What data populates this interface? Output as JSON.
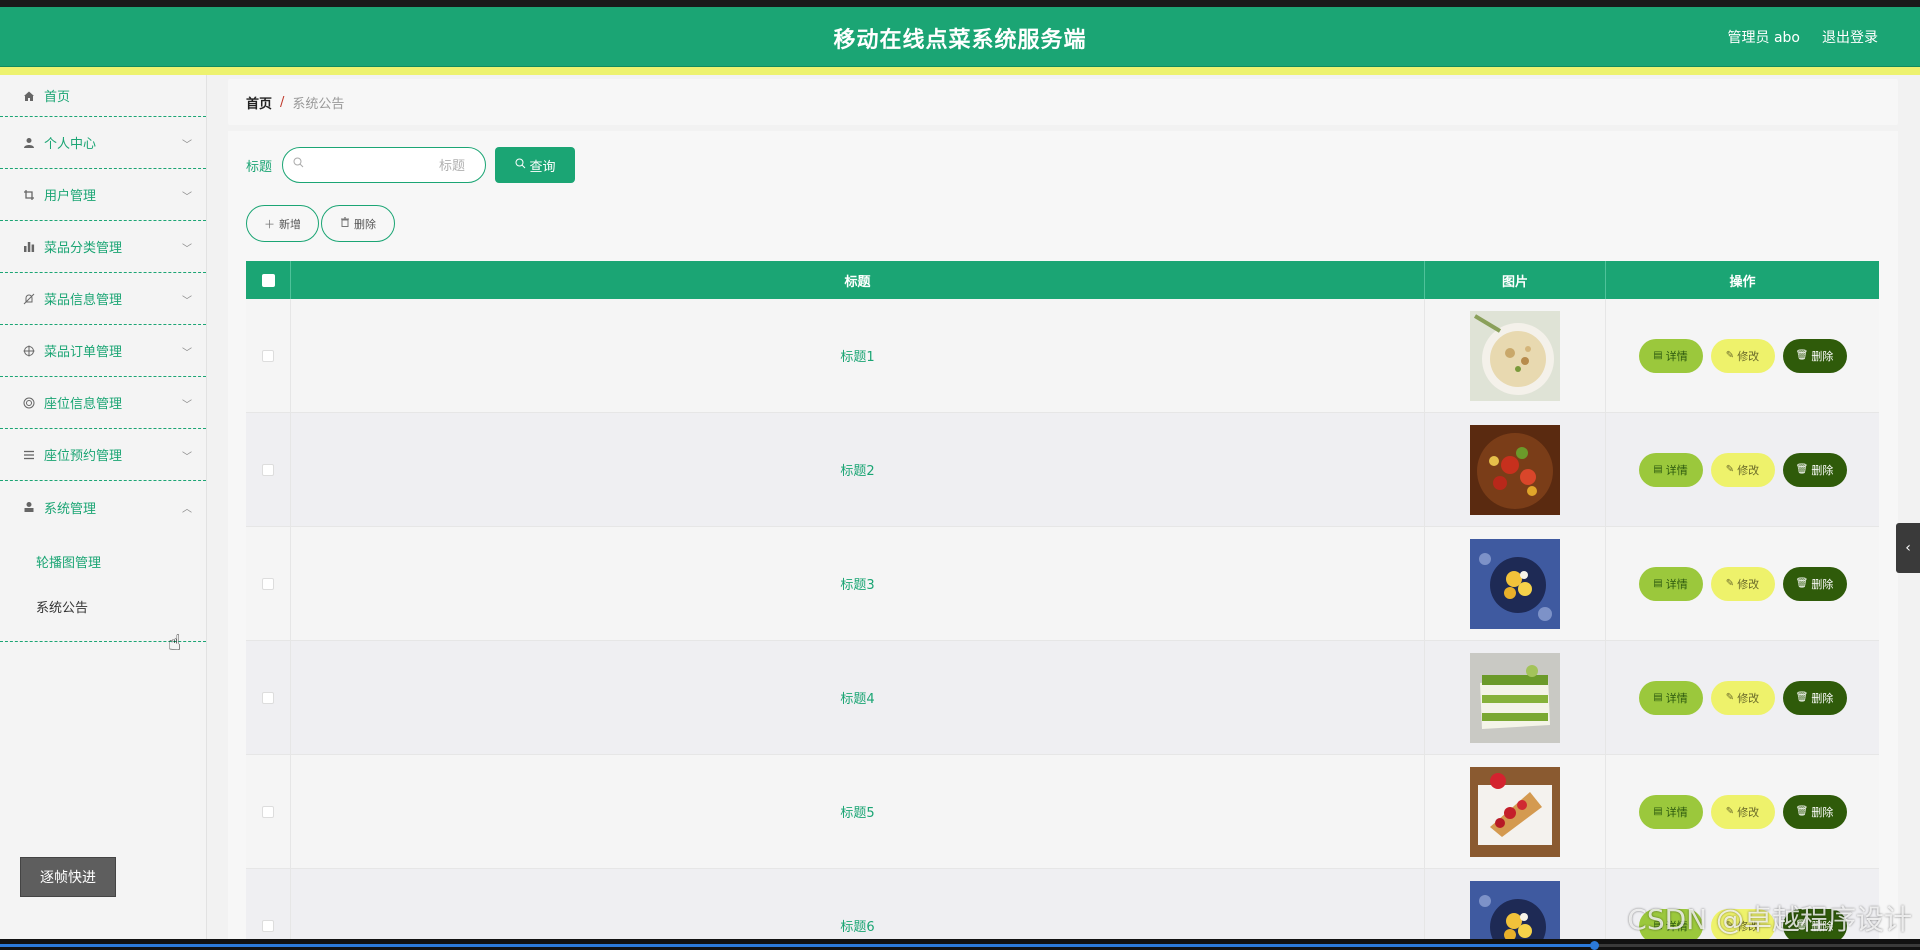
{
  "header": {
    "title": "移动在线点菜系统服务端",
    "user": "管理员 abo",
    "logout": "退出登录"
  },
  "sidebar": {
    "items": [
      {
        "label": "首页",
        "icon": "home-icon"
      },
      {
        "label": "个人中心",
        "icon": "user-icon"
      },
      {
        "label": "用户管理",
        "icon": "crop-icon"
      },
      {
        "label": "菜品分类管理",
        "icon": "bar-chart-icon"
      },
      {
        "label": "菜品信息管理",
        "icon": "bell-off-icon"
      },
      {
        "label": "菜品订单管理",
        "icon": "target-icon"
      },
      {
        "label": "座位信息管理",
        "icon": "circle-icon"
      },
      {
        "label": "座位预约管理",
        "icon": "list-icon"
      },
      {
        "label": "系统管理",
        "icon": "person-icon"
      }
    ],
    "submenu": [
      "轮播图管理",
      "系统公告"
    ],
    "frame_button": "逐帧快进"
  },
  "breadcrumb": {
    "home": "首页",
    "separator": "/",
    "current": "系统公告"
  },
  "search": {
    "label": "标题",
    "placeholder": "标题",
    "button": "查询"
  },
  "actions": {
    "add": "新增",
    "delete": "删除"
  },
  "table": {
    "headers": [
      "标题",
      "图片",
      "操作"
    ],
    "rows": [
      {
        "title": "标题1",
        "image": "soup-bowl"
      },
      {
        "title": "标题2",
        "image": "spicy-dish"
      },
      {
        "title": "标题3",
        "image": "mango-dessert"
      },
      {
        "title": "标题4",
        "image": "matcha-cake"
      },
      {
        "title": "标题5",
        "image": "strawberry-crepe"
      },
      {
        "title": "标题6",
        "image": "mango-dessert"
      }
    ],
    "op_labels": {
      "detail": "详情",
      "edit": "修改",
      "delete": "删除"
    }
  },
  "watermark": "CSDN @卓越程序设计",
  "video_progress": 0.83,
  "colors": {
    "accent": "#1ba574",
    "yellow": "#edf26f",
    "detail": "#9bc83c",
    "edit": "#eef26b",
    "delete": "#2f5b0a"
  }
}
